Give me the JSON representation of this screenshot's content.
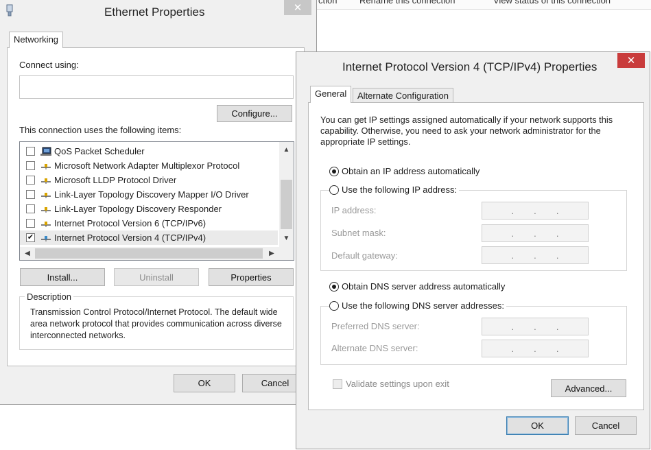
{
  "background_window": {
    "commands": [
      "ction",
      "Rename this connection",
      "View status of this connection"
    ]
  },
  "ethernet": {
    "title": "Ethernet Properties",
    "tab_label": "Networking",
    "connect_using_label": "Connect using:",
    "adapter_value": "",
    "configure_label": "Configure...",
    "items_label": "This connection uses the following items:",
    "items": [
      {
        "label": "QoS Packet Scheduler",
        "checked": false,
        "icon": "network-monitor-icon"
      },
      {
        "label": "Microsoft Network Adapter Multiplexor Protocol",
        "checked": false,
        "icon": "protocol-icon"
      },
      {
        "label": "Microsoft LLDP Protocol Driver",
        "checked": false,
        "icon": "protocol-icon"
      },
      {
        "label": "Link-Layer Topology Discovery Mapper I/O Driver",
        "checked": false,
        "icon": "protocol-icon"
      },
      {
        "label": "Link-Layer Topology Discovery Responder",
        "checked": false,
        "icon": "protocol-icon"
      },
      {
        "label": "Internet Protocol Version 6 (TCP/IPv6)",
        "checked": false,
        "icon": "protocol-icon"
      },
      {
        "label": "Internet Protocol Version 4 (TCP/IPv4)",
        "checked": true,
        "icon": "protocol-icon"
      }
    ],
    "install_label": "Install...",
    "uninstall_label": "Uninstall",
    "properties_label": "Properties",
    "description_legend": "Description",
    "description_text": "Transmission Control Protocol/Internet Protocol. The default wide area network protocol that provides communication across diverse interconnected networks.",
    "ok_label": "OK",
    "cancel_label": "Cancel"
  },
  "ipv4": {
    "title": "Internet Protocol Version 4 (TCP/IPv4) Properties",
    "tab_general": "General",
    "tab_alternate": "Alternate Configuration",
    "intro": "You can get IP settings assigned automatically if your network supports this capability. Otherwise, you need to ask your network administrator for the appropriate IP settings.",
    "obtain_ip_auto": "Obtain an IP address automatically",
    "use_following_ip": "Use the following IP address:",
    "ip_address_label": "IP address:",
    "subnet_mask_label": "Subnet mask:",
    "default_gateway_label": "Default gateway:",
    "obtain_dns_auto": "Obtain DNS server address automatically",
    "use_following_dns": "Use the following DNS server addresses:",
    "preferred_dns_label": "Preferred DNS server:",
    "alternate_dns_label": "Alternate DNS server:",
    "validate_label": "Validate settings upon exit",
    "advanced_label": "Advanced...",
    "ok_label": "OK",
    "cancel_label": "Cancel",
    "ip_selection": "automatic",
    "dns_selection": "automatic",
    "validate_checked": false
  },
  "colors": {
    "dialog_bg": "#f0f0f0",
    "close_active": "#c93c3c",
    "close_inactive": "#c7c7c7",
    "default_button_border": "#3c7fb1"
  }
}
